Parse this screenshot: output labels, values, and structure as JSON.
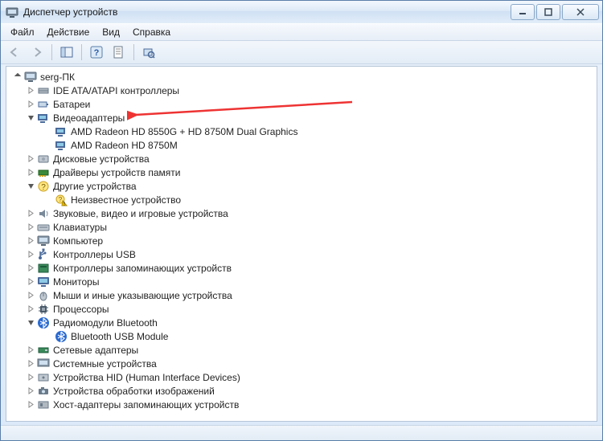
{
  "window": {
    "title": "Диспетчер устройств"
  },
  "menu": {
    "file": "Файл",
    "action": "Действие",
    "view": "Вид",
    "help": "Справка"
  },
  "tree": {
    "root": "serg-ПК",
    "ide": "IDE ATA/ATAPI контроллеры",
    "batteries": "Батареи",
    "video_adapters": "Видеоадаптеры",
    "video1": "AMD Radeon HD 8550G + HD 8750M Dual Graphics",
    "video2": "AMD Radeon HD 8750M",
    "disk": "Дисковые устройства",
    "mem_drivers": "Драйверы устройств памяти",
    "other": "Другие устройства",
    "unknown": "Неизвестное устройство",
    "sound": "Звуковые, видео и игровые устройства",
    "keyboards": "Клавиатуры",
    "computer": "Компьютер",
    "usb_controllers": "Контроллеры USB",
    "storage_controllers": "Контроллеры запоминающих устройств",
    "monitors": "Мониторы",
    "mice": "Мыши и иные указывающие устройства",
    "processors": "Процессоры",
    "bluetooth": "Радиомодули Bluetooth",
    "bt_usb": "Bluetooth USB Module",
    "network": "Сетевые адаптеры",
    "system": "Системные устройства",
    "hid": "Устройства HID (Human Interface Devices)",
    "imaging": "Устройства обработки изображений",
    "host_storage": "Хост-адаптеры запоминающих устройств"
  }
}
